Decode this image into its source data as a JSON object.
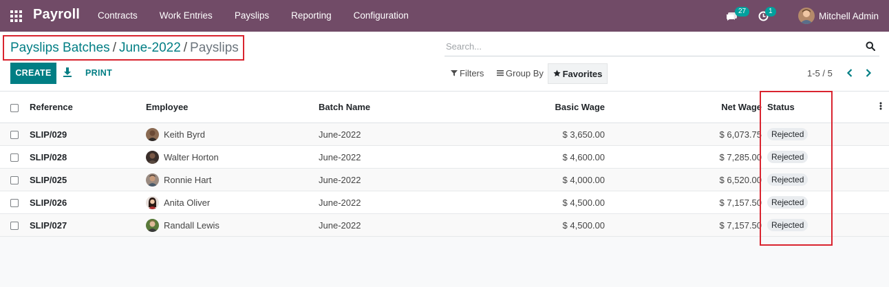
{
  "navbar": {
    "app_title": "Payroll",
    "menu": [
      "Contracts",
      "Work Entries",
      "Payslips",
      "Reporting",
      "Configuration"
    ],
    "chat_count": "27",
    "activity_count": "1",
    "user_name": "Mitchell Admin",
    "color": "#714B67"
  },
  "breadcrumb": {
    "item1": "Payslips Batches",
    "item2": "June-2022",
    "current": "Payslips",
    "separator": "/"
  },
  "search": {
    "placeholder": "Search..."
  },
  "toolbar": {
    "create_label": "CREATE",
    "print_label": "PRINT"
  },
  "filters": {
    "filters_label": "Filters",
    "groupby_label": "Group By",
    "favorites_label": "Favorites"
  },
  "pager": {
    "value": "1-5 / 5"
  },
  "table": {
    "headers": {
      "reference": "Reference",
      "employee": "Employee",
      "batch": "Batch Name",
      "basic": "Basic Wage",
      "net": "Net Wage",
      "status": "Status"
    },
    "rows": [
      {
        "reference": "SLIP/029",
        "employee": "Keith Byrd",
        "batch": "June-2022",
        "basic": "$ 3,650.00",
        "net": "$ 6,073.75",
        "status": "Rejected"
      },
      {
        "reference": "SLIP/028",
        "employee": "Walter Horton",
        "batch": "June-2022",
        "basic": "$ 4,600.00",
        "net": "$ 7,285.00",
        "status": "Rejected"
      },
      {
        "reference": "SLIP/025",
        "employee": "Ronnie Hart",
        "batch": "June-2022",
        "basic": "$ 4,000.00",
        "net": "$ 6,520.00",
        "status": "Rejected"
      },
      {
        "reference": "SLIP/026",
        "employee": "Anita Oliver",
        "batch": "June-2022",
        "basic": "$ 4,500.00",
        "net": "$ 7,157.50",
        "status": "Rejected"
      },
      {
        "reference": "SLIP/027",
        "employee": "Randall Lewis",
        "batch": "June-2022",
        "basic": "$ 4,500.00",
        "net": "$ 7,157.50",
        "status": "Rejected"
      }
    ]
  },
  "colors": {
    "accent": "#017e84",
    "highlight": "#d9232e",
    "badge": "#00A09D"
  }
}
